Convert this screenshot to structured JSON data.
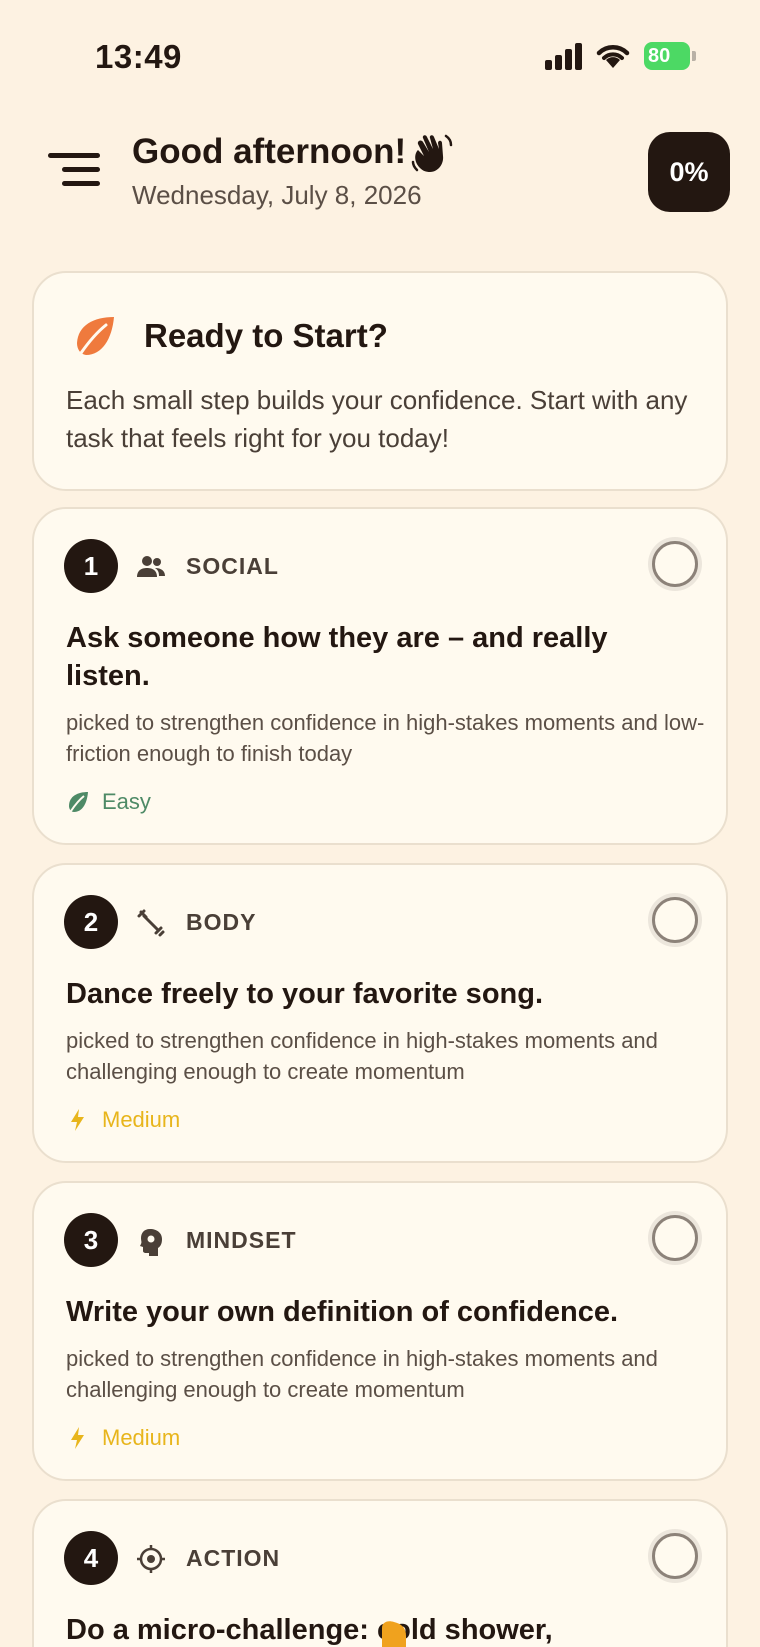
{
  "status_bar": {
    "time": "13:49",
    "battery": "80"
  },
  "header": {
    "greeting": "Good afternoon!",
    "date": "Wednesday, July 8, 2026",
    "progress": "0%"
  },
  "intro": {
    "title": "Ready to Start?",
    "text": "Each small step builds your confidence. Start with any task that feels right for you today!"
  },
  "tasks": [
    {
      "number": "1",
      "category": "SOCIAL",
      "category_icon": "people-icon",
      "title": "Ask someone how they are – and really listen.",
      "description": "picked to strengthen confidence in high-stakes moments and low-friction enough to finish today",
      "difficulty": "Easy"
    },
    {
      "number": "2",
      "category": "BODY",
      "category_icon": "dumbbell-icon",
      "title": "Dance freely to your favorite song.",
      "description": "picked to strengthen confidence in high-stakes moments and challenging enough to create momentum",
      "difficulty": "Medium"
    },
    {
      "number": "3",
      "category": "MINDSET",
      "category_icon": "brain-head-icon",
      "title": "Write your own definition of confidence.",
      "description": "picked to strengthen confidence in high-stakes moments and challenging enough to create momentum",
      "difficulty": "Medium"
    },
    {
      "number": "4",
      "category": "ACTION",
      "category_icon": "target-icon",
      "title": "Do a micro-challenge: cold shower,",
      "description": "",
      "difficulty": ""
    }
  ],
  "colors": {
    "background": "#fdf2e2",
    "card": "#fffaef",
    "dark": "#231711",
    "accent_orange": "#ef7a3d",
    "easy_green": "#4e8a66",
    "medium_yellow": "#e8b51c"
  }
}
